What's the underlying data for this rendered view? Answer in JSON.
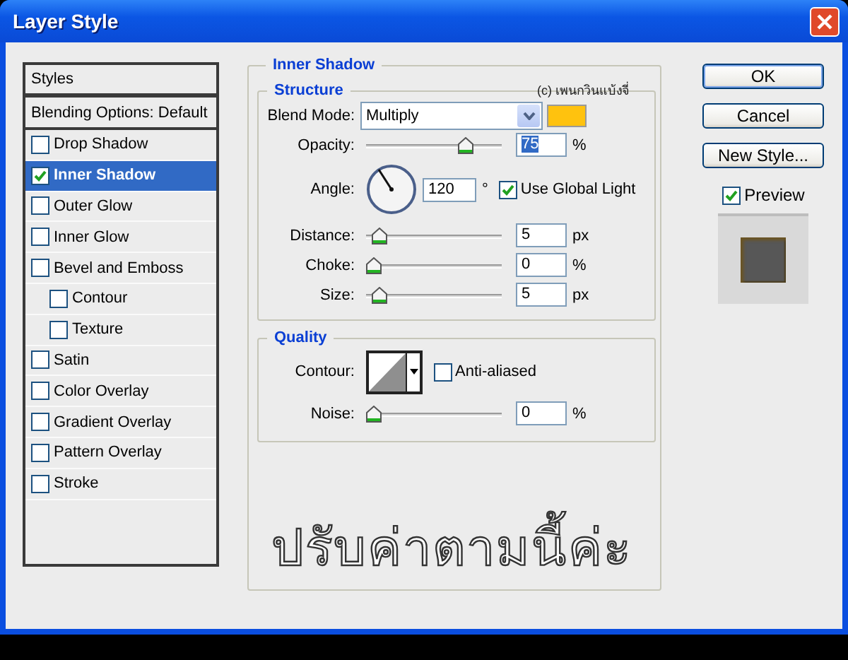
{
  "window": {
    "title": "Layer Style"
  },
  "styles_list": {
    "header": "Styles",
    "blending_options": "Blending Options: Default",
    "items": [
      {
        "label": "Drop Shadow",
        "checked": false,
        "selected": false
      },
      {
        "label": "Inner Shadow",
        "checked": true,
        "selected": true
      },
      {
        "label": "Outer Glow",
        "checked": false,
        "selected": false
      },
      {
        "label": "Inner Glow",
        "checked": false,
        "selected": false
      },
      {
        "label": "Bevel and Emboss",
        "checked": false,
        "selected": false,
        "children": [
          {
            "label": "Contour",
            "checked": false,
            "selected": false
          },
          {
            "label": "Texture",
            "checked": false,
            "selected": false
          }
        ]
      },
      {
        "label": "Satin",
        "checked": false,
        "selected": false
      },
      {
        "label": "Color Overlay",
        "checked": false,
        "selected": false
      },
      {
        "label": "Gradient Overlay",
        "checked": false,
        "selected": false
      },
      {
        "label": "Pattern Overlay",
        "checked": false,
        "selected": false
      },
      {
        "label": "Stroke",
        "checked": false,
        "selected": false
      }
    ]
  },
  "panel": {
    "title": "Inner Shadow",
    "credit": "(c) เพนกวินแบ้งจี่",
    "structure": {
      "title": "Structure",
      "rows": [
        {
          "kind": "select",
          "label": "Blend Mode:",
          "value": "Multiply",
          "color": "#ffc20e"
        },
        {
          "kind": "slider",
          "label": "Opacity:",
          "level": 0.77,
          "value": "75",
          "unit": "%",
          "value_selected": true
        },
        {
          "kind": "angle",
          "label": "Angle:",
          "value": "120",
          "unit": "°",
          "option": {
            "label": "Use Global Light",
            "checked": true
          }
        },
        {
          "kind": "slider",
          "label": "Distance:",
          "level": 0.05,
          "value": "5",
          "unit": "px",
          "value_selected": false
        },
        {
          "kind": "slider",
          "label": "Choke:",
          "level": 0,
          "value": "0",
          "unit": "%",
          "value_selected": false
        },
        {
          "kind": "slider",
          "label": "Size:",
          "level": 0.05,
          "value": "5",
          "unit": "px",
          "value_selected": false
        }
      ]
    },
    "quality": {
      "title": "Quality",
      "rows": [
        {
          "kind": "contour",
          "label": "Contour:",
          "option": {
            "label": "Anti-aliased",
            "checked": false
          }
        },
        {
          "kind": "slider",
          "label": "Noise:",
          "level": 0,
          "value": "0",
          "unit": "%",
          "value_selected": false
        }
      ]
    }
  },
  "annotation": "ปรับค่าตามนี้ค่ะ",
  "buttons": [
    {
      "label": "OK",
      "default": true
    },
    {
      "label": "Cancel",
      "default": false
    },
    {
      "label": "New Style...",
      "default": false
    }
  ],
  "preview": {
    "label": "Preview",
    "checked": true
  }
}
